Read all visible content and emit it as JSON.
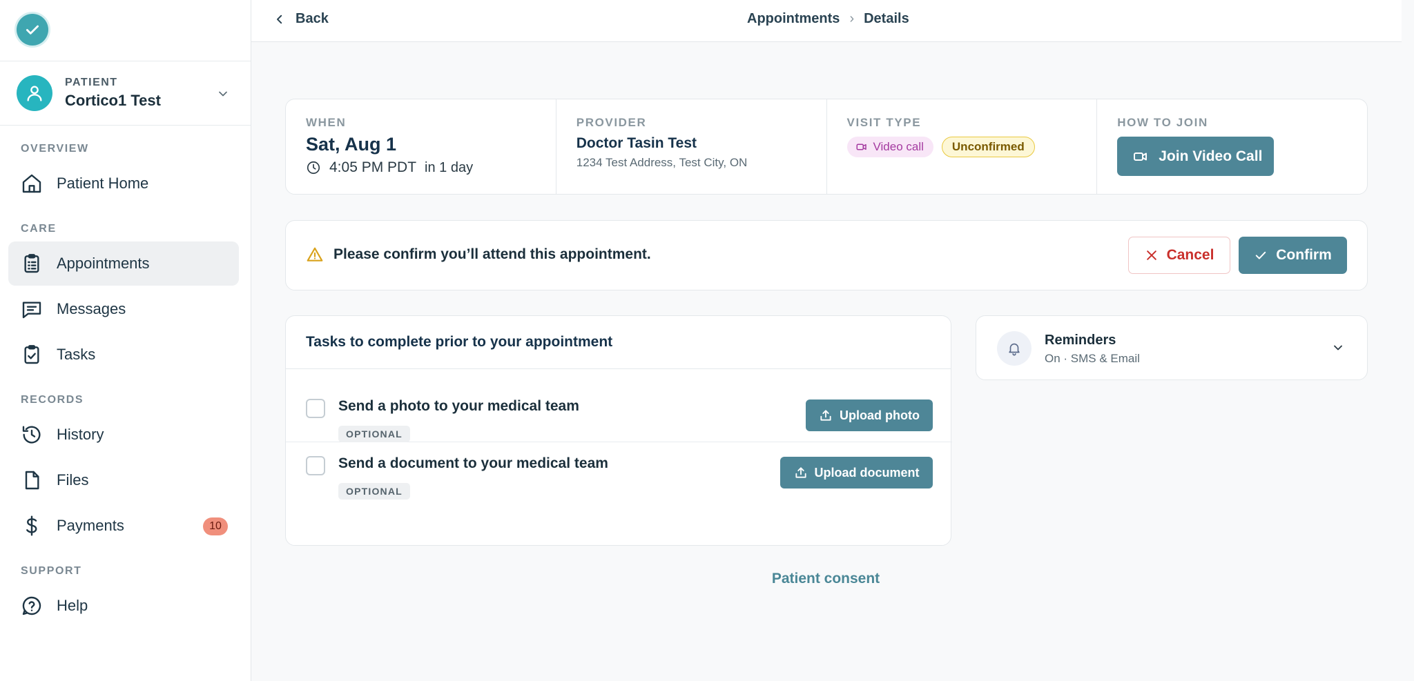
{
  "topbar": {
    "back_label": "Back",
    "breadcrumb": [
      "Appointments",
      "Details"
    ]
  },
  "sidebar": {
    "patient_caption": "PATIENT",
    "patient_name": "Cortico1 Test",
    "sections": {
      "overview": "OVERVIEW",
      "care": "CARE",
      "records": "RECORDS",
      "support": "SUPPORT"
    },
    "items": [
      {
        "label": "Patient Home",
        "icon": "home-icon"
      },
      {
        "label": "Appointments",
        "icon": "clipboard-icon",
        "active": true
      },
      {
        "label": "Messages",
        "icon": "message-icon"
      },
      {
        "label": "Tasks",
        "icon": "clipboard-check-icon"
      },
      {
        "label": "History",
        "icon": "history-icon"
      },
      {
        "label": "Files",
        "icon": "file-icon"
      },
      {
        "label": "Payments",
        "icon": "dollar-icon",
        "badge": "10"
      },
      {
        "label": "Help",
        "icon": "help-icon"
      }
    ]
  },
  "summary": {
    "when": {
      "caption": "WHEN",
      "date": "Sat, Aug 1",
      "time": "4:05 PM PDT",
      "relative": "in 1 day"
    },
    "provider": {
      "caption": "PROVIDER",
      "name": "Doctor Tasin Test",
      "address": "1234 Test Address, Test City, ON"
    },
    "visit_type": {
      "caption": "VISIT TYPE",
      "type_label": "Video call",
      "status_label": "Unconfirmed"
    },
    "join": {
      "caption": "HOW TO JOIN",
      "button_label": "Join Video Call"
    }
  },
  "confirm": {
    "message": "Please confirm you’ll attend this appointment.",
    "cancel_label": "Cancel",
    "confirm_label": "Confirm"
  },
  "tasks": {
    "title": "Tasks to complete prior to your appointment",
    "items": [
      {
        "title": "Send a photo to your medical team",
        "badge": "OPTIONAL",
        "button_label": "Upload photo"
      },
      {
        "title": "Send a document to your medical team",
        "badge": "OPTIONAL",
        "button_label": "Upload document"
      }
    ]
  },
  "reminders": {
    "title": "Reminders",
    "subtitle": "On · SMS & Email"
  },
  "footer": {
    "consent_label": "Patient consent"
  },
  "colors": {
    "accent": "#4e8697",
    "brand": "#3fa6b0",
    "danger": "#c9302c",
    "warning": "#d9a21b",
    "badge": "#f08f7c"
  }
}
